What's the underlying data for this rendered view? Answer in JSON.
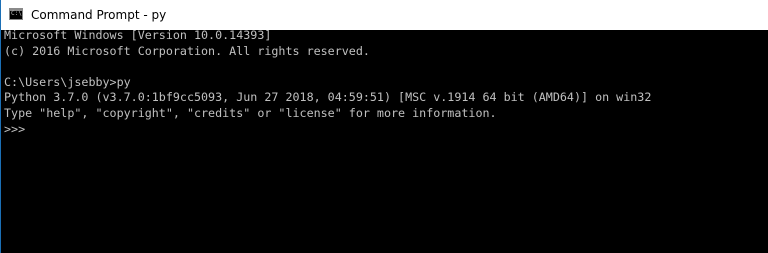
{
  "window": {
    "title": "Command Prompt - py",
    "icon": "cmd-icon",
    "icon_prompt": "C:\\"
  },
  "console": {
    "lines": [
      "Microsoft Windows [Version 10.0.14393]",
      "(c) 2016 Microsoft Corporation. All rights reserved.",
      "",
      "C:\\Users\\jsebby>py",
      "Python 3.7.0 (v3.7.0:1bf9cc5093, Jun 27 2018, 04:59:51) [MSC v.1914 64 bit (AMD64)] on win32",
      "Type \"help\", \"copyright\", \"credits\" or \"license\" for more information.",
      ">>>"
    ]
  },
  "colors": {
    "background": "#000000",
    "text": "#c0c0c0",
    "titlebar": "#ffffff",
    "window_border": "#1b6fb5"
  }
}
